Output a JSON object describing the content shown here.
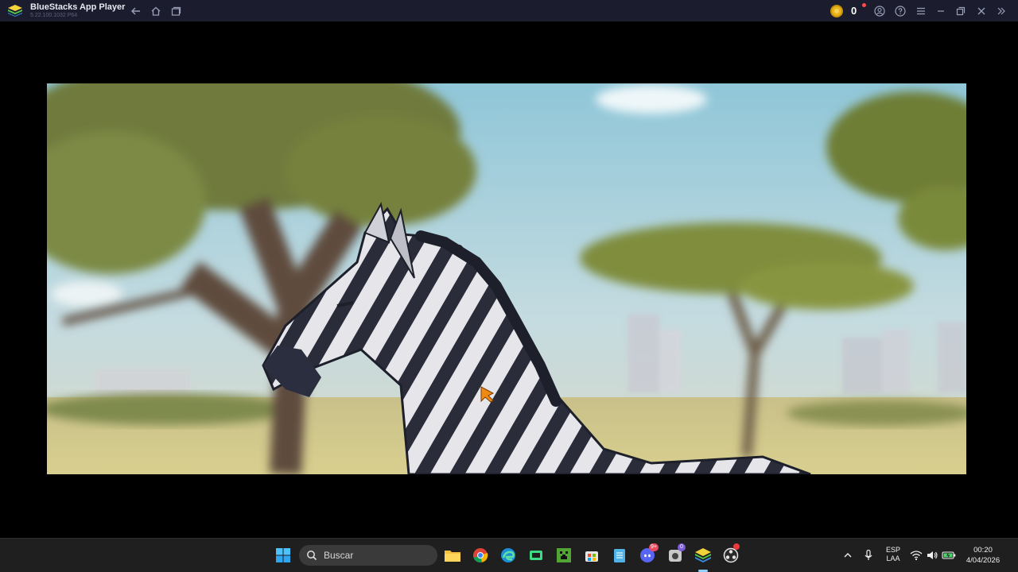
{
  "titlebar": {
    "app_title": "BlueStacks App Player",
    "app_version": "5.22.100.1032 P64",
    "coins": "0",
    "icons": [
      "bluestacks-logo",
      "back-icon",
      "home-icon",
      "multi-instance-icon",
      "coin-icon",
      "account-icon",
      "help-icon",
      "menu-icon",
      "minimize-icon",
      "restore-icon",
      "close-icon",
      "collapse-sidebar-icon"
    ]
  },
  "video": {
    "description_icons": [
      "zebra",
      "acacia-tree",
      "city-skyline",
      "savanna"
    ]
  },
  "taskbar": {
    "search_placeholder": "Buscar",
    "apps": [
      "windows-start-icon",
      "search-icon",
      "file-explorer-icon",
      "chrome-icon",
      "edge-icon",
      "android-studio-icon",
      "minecraft-icon",
      "microsoft-store-icon",
      "notepad-icon",
      "discord-icon",
      "steam-icon",
      "bluestacks-icon",
      "obs-icon"
    ],
    "discord_badge": "9+",
    "steam_badge": "0",
    "language_line1": "ESP",
    "language_line2": "LAA",
    "time": "00:20",
    "date": "4/04/2026"
  },
  "colors": {
    "titlebar_bg": "#1b1d2e",
    "taskbar_bg": "#1f1f1f",
    "accent_coin": "#e8b418"
  }
}
